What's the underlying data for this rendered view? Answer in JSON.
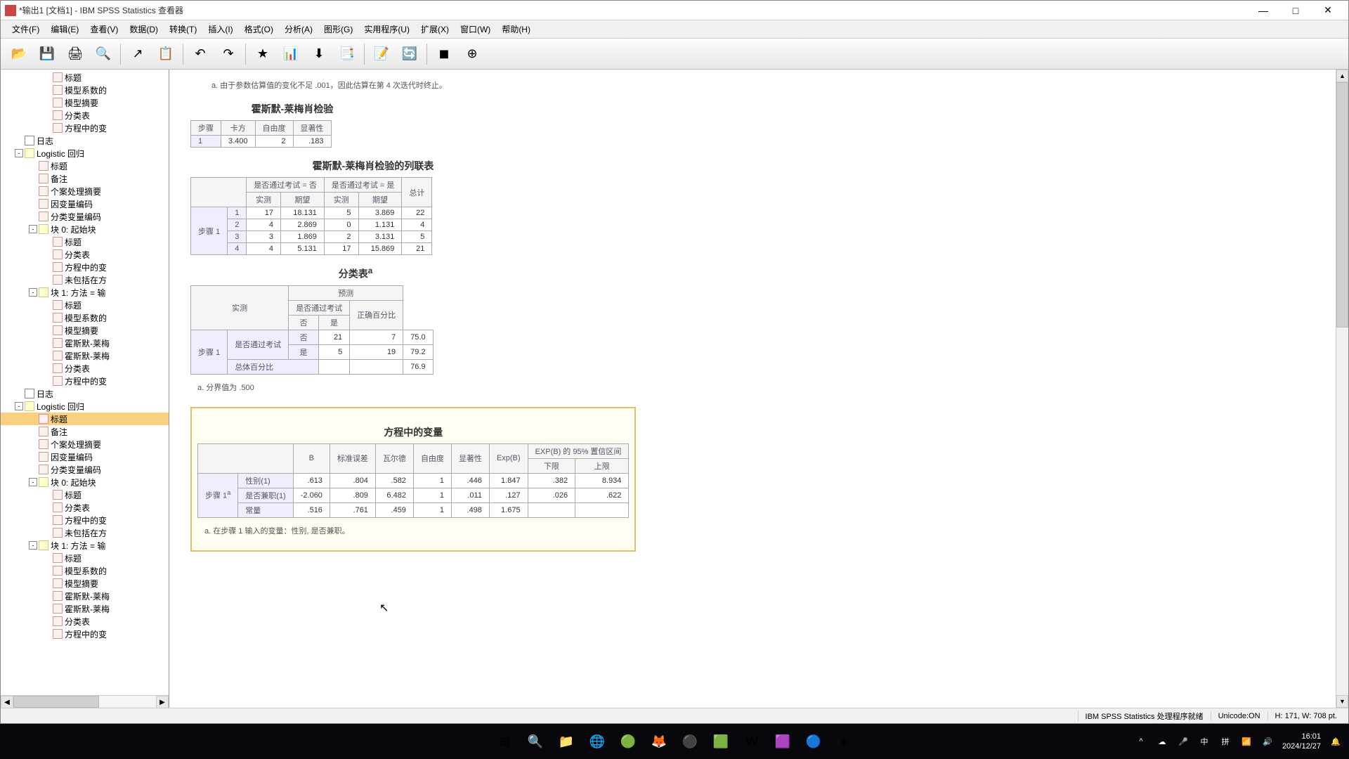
{
  "window": {
    "title": "*输出1 [文档1] - IBM SPSS Statistics 查看器"
  },
  "win_controls": {
    "min": "—",
    "max": "□",
    "close": "✕"
  },
  "menu": [
    "文件(F)",
    "编辑(E)",
    "查看(V)",
    "数据(D)",
    "转换(T)",
    "插入(I)",
    "格式(O)",
    "分析(A)",
    "图形(G)",
    "实用程序(U)",
    "扩展(X)",
    "窗口(W)",
    "帮助(H)"
  ],
  "toolbar_icons": [
    "📂",
    "💾",
    "🖨",
    "🔍",
    "↗",
    "📋",
    "↶",
    "↷",
    "★",
    "📊",
    "⬇",
    "📑",
    "📝",
    "🔄",
    "◼",
    "⊕"
  ],
  "tree": [
    {
      "indent": 60,
      "toggle": "",
      "icon": "ti-item",
      "label": "标题"
    },
    {
      "indent": 60,
      "toggle": "",
      "icon": "ti-item",
      "label": "模型系数的"
    },
    {
      "indent": 60,
      "toggle": "",
      "icon": "ti-item",
      "label": "模型摘要"
    },
    {
      "indent": 60,
      "toggle": "",
      "icon": "ti-item",
      "label": "分类表"
    },
    {
      "indent": 60,
      "toggle": "",
      "icon": "ti-item",
      "label": "方程中的变"
    },
    {
      "indent": 20,
      "toggle": "",
      "icon": "ti-log",
      "label": "日志"
    },
    {
      "indent": 20,
      "toggle": "-",
      "icon": "ti-folder",
      "label": "Logistic 回归"
    },
    {
      "indent": 40,
      "toggle": "",
      "icon": "ti-item",
      "label": "标题"
    },
    {
      "indent": 40,
      "toggle": "",
      "icon": "ti-item",
      "label": "备注"
    },
    {
      "indent": 40,
      "toggle": "",
      "icon": "ti-item",
      "label": "个案处理摘要"
    },
    {
      "indent": 40,
      "toggle": "",
      "icon": "ti-item",
      "label": "因变量编码"
    },
    {
      "indent": 40,
      "toggle": "",
      "icon": "ti-item",
      "label": "分类变量编码"
    },
    {
      "indent": 40,
      "toggle": "-",
      "icon": "ti-folder",
      "label": "块 0: 起始块"
    },
    {
      "indent": 60,
      "toggle": "",
      "icon": "ti-item",
      "label": "标题"
    },
    {
      "indent": 60,
      "toggle": "",
      "icon": "ti-item",
      "label": "分类表"
    },
    {
      "indent": 60,
      "toggle": "",
      "icon": "ti-item",
      "label": "方程中的变"
    },
    {
      "indent": 60,
      "toggle": "",
      "icon": "ti-item",
      "label": "未包括在方"
    },
    {
      "indent": 40,
      "toggle": "-",
      "icon": "ti-folder",
      "label": "块 1: 方法 = 输"
    },
    {
      "indent": 60,
      "toggle": "",
      "icon": "ti-item",
      "label": "标题"
    },
    {
      "indent": 60,
      "toggle": "",
      "icon": "ti-item",
      "label": "模型系数的"
    },
    {
      "indent": 60,
      "toggle": "",
      "icon": "ti-item",
      "label": "模型摘要"
    },
    {
      "indent": 60,
      "toggle": "",
      "icon": "ti-item",
      "label": "霍斯默-莱梅"
    },
    {
      "indent": 60,
      "toggle": "",
      "icon": "ti-item",
      "label": "霍斯默-莱梅"
    },
    {
      "indent": 60,
      "toggle": "",
      "icon": "ti-item",
      "label": "分类表"
    },
    {
      "indent": 60,
      "toggle": "",
      "icon": "ti-item",
      "label": "方程中的变"
    },
    {
      "indent": 20,
      "toggle": "",
      "icon": "ti-log",
      "label": "日志"
    },
    {
      "indent": 20,
      "toggle": "-",
      "icon": "ti-folder",
      "label": "Logistic 回归"
    },
    {
      "indent": 40,
      "toggle": "",
      "icon": "ti-item",
      "label": "标题",
      "sel": true
    },
    {
      "indent": 40,
      "toggle": "",
      "icon": "ti-item",
      "label": "备注"
    },
    {
      "indent": 40,
      "toggle": "",
      "icon": "ti-item",
      "label": "个案处理摘要"
    },
    {
      "indent": 40,
      "toggle": "",
      "icon": "ti-item",
      "label": "因变量编码"
    },
    {
      "indent": 40,
      "toggle": "",
      "icon": "ti-item",
      "label": "分类变量编码"
    },
    {
      "indent": 40,
      "toggle": "-",
      "icon": "ti-folder",
      "label": "块 0: 起始块"
    },
    {
      "indent": 60,
      "toggle": "",
      "icon": "ti-item",
      "label": "标题"
    },
    {
      "indent": 60,
      "toggle": "",
      "icon": "ti-item",
      "label": "分类表"
    },
    {
      "indent": 60,
      "toggle": "",
      "icon": "ti-item",
      "label": "方程中的变"
    },
    {
      "indent": 60,
      "toggle": "",
      "icon": "ti-item",
      "label": "未包括在方"
    },
    {
      "indent": 40,
      "toggle": "-",
      "icon": "ti-folder",
      "label": "块 1: 方法 = 输"
    },
    {
      "indent": 60,
      "toggle": "",
      "icon": "ti-item",
      "label": "标题"
    },
    {
      "indent": 60,
      "toggle": "",
      "icon": "ti-item",
      "label": "模型系数的"
    },
    {
      "indent": 60,
      "toggle": "",
      "icon": "ti-item",
      "label": "模型摘要"
    },
    {
      "indent": 60,
      "toggle": "",
      "icon": "ti-item",
      "label": "霍斯默-莱梅"
    },
    {
      "indent": 60,
      "toggle": "",
      "icon": "ti-item",
      "label": "霍斯默-莱梅"
    },
    {
      "indent": 60,
      "toggle": "",
      "icon": "ti-item",
      "label": "分类表"
    },
    {
      "indent": 60,
      "toggle": "",
      "icon": "ti-item",
      "label": "方程中的变"
    }
  ],
  "output": {
    "note_top": "a. 由于参数估算值的变化不足 .001，因此估算在第 4 次迭代时终止。",
    "hl_test": {
      "title": "霍斯默-莱梅肖检验",
      "headers": [
        "步骤",
        "卡方",
        "自由度",
        "显著性"
      ],
      "row": [
        "1",
        "3.400",
        "2",
        ".183"
      ]
    },
    "contingency": {
      "title": "霍斯默-莱梅肖检验的列联表",
      "group1": "是否通过考试 = 否",
      "group2": "是否通过考试 = 是",
      "sub": [
        "实测",
        "期望",
        "实测",
        "期望",
        "总计"
      ],
      "step": "步骤 1",
      "rows": [
        [
          "1",
          "17",
          "18.131",
          "5",
          "3.869",
          "22"
        ],
        [
          "2",
          "4",
          "2.869",
          "0",
          "1.131",
          "4"
        ],
        [
          "3",
          "3",
          "1.869",
          "2",
          "3.131",
          "5"
        ],
        [
          "4",
          "4",
          "5.131",
          "17",
          "15.869",
          "21"
        ]
      ]
    },
    "class_table": {
      "title": "分类表",
      "sup": "a",
      "pred": "预测",
      "exam": "是否通过考试",
      "no": "否",
      "yes": "是",
      "correct": "正确百分比",
      "obs": "实测",
      "total": "总体百分比",
      "step": "步骤 1",
      "rows": [
        [
          "否",
          "21",
          "7",
          "75.0"
        ],
        [
          "是",
          "5",
          "19",
          "79.2"
        ],
        [
          "",
          "",
          "",
          "76.9"
        ]
      ],
      "note": "a. 分界值为 .500"
    },
    "equation": {
      "title": "方程中的变量",
      "ci_header": "EXP(B) 的 95% 置信区间",
      "headers": [
        "B",
        "标准误差",
        "瓦尔德",
        "自由度",
        "显著性",
        "Exp(B)",
        "下限",
        "上限"
      ],
      "step": "步骤 1",
      "sup": "a",
      "rows": [
        [
          "性别(1)",
          ".613",
          ".804",
          ".582",
          "1",
          ".446",
          "1.847",
          ".382",
          "8.934"
        ],
        [
          "是否兼职(1)",
          "-2.060",
          ".809",
          "6.482",
          "1",
          ".011",
          ".127",
          ".026",
          ".622"
        ],
        [
          "常量",
          ".516",
          ".761",
          ".459",
          "1",
          ".498",
          "1.675",
          "",
          ""
        ]
      ],
      "note": "a. 在步骤 1 输入的变量：性别, 是否兼职。"
    }
  },
  "status": {
    "proc": "IBM SPSS Statistics 处理程序就绪",
    "unicode": "Unicode:ON",
    "coords": "H: 171, W: 708 pt."
  },
  "taskbar_icons": [
    "⊞",
    "🔍",
    "📁",
    "🌐",
    "🟢",
    "🦊",
    "⚫",
    "🟩",
    "W",
    "🟪",
    "🔵",
    "◐"
  ],
  "tray": {
    "up": "^",
    "cloud": "☁",
    "mic": "🎤",
    "ime": "中",
    "kbd": "拼",
    "wifi": "📶",
    "vol": "🔊",
    "bell": "🔔"
  },
  "clock": {
    "time": "16:01",
    "date": "2024/12/27"
  }
}
